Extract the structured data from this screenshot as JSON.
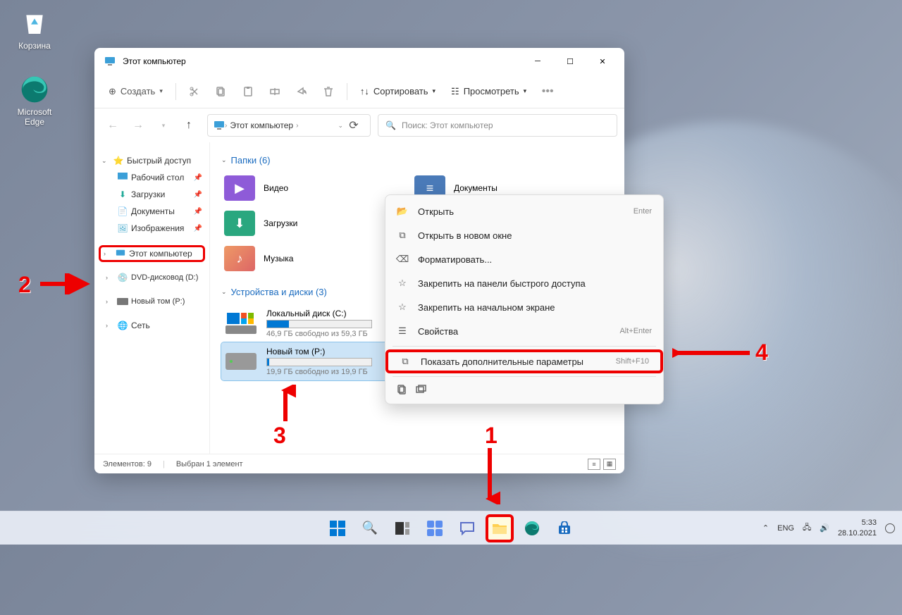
{
  "desktop": {
    "recycle": "Корзина",
    "edge": "Microsoft\nEdge"
  },
  "window": {
    "title": "Этот компьютер",
    "toolbar": {
      "create": "Создать",
      "sort": "Сортировать",
      "view": "Просмотреть"
    },
    "breadcrumb": "Этот компьютер",
    "search_placeholder": "Поиск: Этот компьютер",
    "sidebar": {
      "quick": "Быстрый доступ",
      "desktop": "Рабочий стол",
      "downloads": "Загрузки",
      "documents": "Документы",
      "pictures": "Изображения",
      "this_pc": "Этот компьютер",
      "dvd": "DVD-дисковод (D:)",
      "volume": "Новый том (P:)",
      "network": "Сеть"
    },
    "content": {
      "folders_header": "Папки (6)",
      "videos": "Видео",
      "documents": "Документы",
      "downloads": "Загрузки",
      "music": "Музыка",
      "drives_header": "Устройства и диски (3)",
      "drive_c": {
        "name": "Локальный диск (C:)",
        "free": "46,9 ГБ свободно из 59,3 ГБ",
        "used_pct": 21
      },
      "drive_p": {
        "name": "Новый том (P:)",
        "free": "19,9 ГБ свободно из 19,9 ГБ",
        "used_pct": 2
      }
    },
    "status": {
      "count": "Элементов: 9",
      "selected": "Выбран 1 элемент"
    }
  },
  "context_menu": {
    "open": "Открыть",
    "open_sc": "Enter",
    "open_new": "Открыть в новом окне",
    "format": "Форматировать...",
    "pin_quick": "Закрепить на панели быстрого доступа",
    "pin_start": "Закрепить на начальном экране",
    "properties": "Свойства",
    "properties_sc": "Alt+Enter",
    "more": "Показать дополнительные параметры",
    "more_sc": "Shift+F10"
  },
  "annotations": {
    "n1": "1",
    "n2": "2",
    "n3": "3",
    "n4": "4"
  },
  "taskbar": {
    "lang": "ENG",
    "time": "5:33",
    "date": "28.10.2021"
  }
}
